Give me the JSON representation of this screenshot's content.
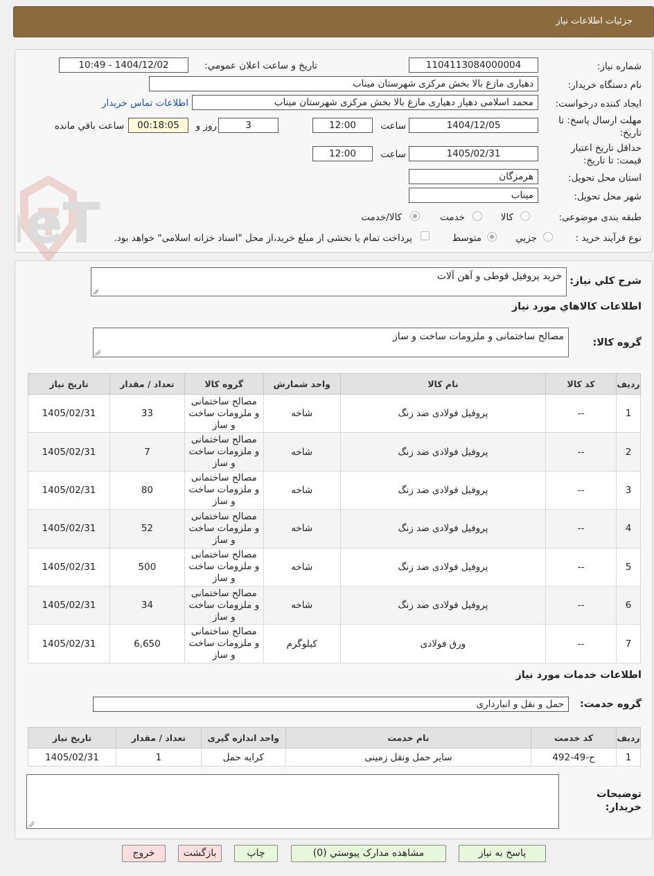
{
  "header": {
    "title": "جزئیات اطلاعات نیاز"
  },
  "details": {
    "need_number_label": "شماره نیاز:",
    "need_number": "1104113084000004",
    "announce_label": "تاریخ و ساعت اعلان عمومي:",
    "announce_value": "1404/12/02 - 10:49",
    "buyer_org_label": "نام دستگاه خريدار:",
    "buyer_org": "دهیاری مازغ بالا بخش مرکزی شهرستان میناب",
    "requester_label": "ایجاد کننده درخواست:",
    "requester": "محمد اسلامی دهیار دهیاری مازغ بالا بخش مرکزی شهرستان میناب",
    "contact_link": "اطلاعات تماس خریدار",
    "reply_deadline_label_1": "مهلت ارسال پاسخ: تا",
    "reply_deadline_label_2": "تاریخ:",
    "reply_date": "1404/12/05",
    "time_label": "ساعت",
    "reply_time": "12:00",
    "days_value": "3",
    "days_label": "روز و",
    "remaining_time": "00:18:05",
    "remaining_label": "ساعت باقي مانده",
    "price_valid_label_1": "حداقل تاریخ اعتبار",
    "price_valid_label_2": "قیمت: تا تاریخ:",
    "price_valid_date": "1405/02/31",
    "price_valid_time": "12:00",
    "province_label": "استان محل تحویل:",
    "province": "هرمزگان",
    "city_label": "شهر محل تحویل:",
    "city": "میناب",
    "category_label": "طبقه بندی موضوعی:",
    "category_options": [
      "کالا",
      "خدمت",
      "کالا/خدمت"
    ],
    "process_label": "نوع فرآیند خرید :",
    "process_options": [
      "جزيي",
      "متوسط"
    ],
    "payment_note": "پرداخت تمام یا بخشی از مبلغ خرید،از محل \"اسناد خزانه اسلامی\" خواهد بود."
  },
  "summary": {
    "description_label": "شرح کلي نياز:",
    "description": "خرید پروفیل قوطی و آهن آلات",
    "goods_section_title": "اطلاعات کالاهاي مورد نياز",
    "goods_group_label": "گروه کالا:",
    "goods_group": "مصالح ساختمانی و ملزومات ساخت و ساز"
  },
  "goods_table": {
    "headers": [
      "رديف",
      "کد کالا",
      "نام کالا",
      "واحد شمارش",
      "گروه کالا",
      "تعداد / مقدار",
      "تاريخ نياز"
    ],
    "rows": [
      [
        "1",
        "--",
        "پروفیل فولادی ضد زنگ",
        "شاخه",
        "مصالح ساختمانی و ملزومات ساخت و ساز",
        "33",
        "1405/02/31"
      ],
      [
        "2",
        "--",
        "پروفیل فولادی ضد زنگ",
        "شاخه",
        "مصالح ساختمانی و ملزومات ساخت و ساز",
        "7",
        "1405/02/31"
      ],
      [
        "3",
        "--",
        "پروفیل فولادی ضد زنگ",
        "شاخه",
        "مصالح ساختمانی و ملزومات ساخت و ساز",
        "80",
        "1405/02/31"
      ],
      [
        "4",
        "--",
        "پروفیل فولادی ضد زنگ",
        "شاخه",
        "مصالح ساختمانی و ملزومات ساخت و ساز",
        "52",
        "1405/02/31"
      ],
      [
        "5",
        "--",
        "پروفیل فولادی ضد زنگ",
        "شاخه",
        "مصالح ساختمانی و ملزومات ساخت و ساز",
        "500",
        "1405/02/31"
      ],
      [
        "6",
        "--",
        "پروفیل فولادی ضد زنگ",
        "شاخه",
        "مصالح ساختمانی و ملزومات ساخت و ساز",
        "34",
        "1405/02/31"
      ],
      [
        "7",
        "--",
        "ورق فولادی",
        "کیلوگرم",
        "مصالح ساختمانی و ملزومات ساخت و ساز",
        "6,650",
        "1405/02/31"
      ]
    ]
  },
  "services": {
    "section_title": "اطلاعات خدمات مورد نياز",
    "group_label": "گروه خدمت:",
    "group": "حمل و نقل و انبارداری"
  },
  "services_table": {
    "headers": [
      "رديف",
      "کد خدمت",
      "نام خدمت",
      "واحد اندازه گيری",
      "تعداد / مقدار",
      "تاريخ نياز"
    ],
    "rows": [
      [
        "1",
        "ح-49-492",
        "سایر حمل ونقل زمینی",
        "کرایه حمل",
        "1",
        "1405/02/31"
      ]
    ]
  },
  "buyer_notes": {
    "label_1": "توضیحات",
    "label_2": "خریدار:",
    "value": ""
  },
  "buttons": {
    "reply": "پاسخ به نیاز",
    "attachments": "مشاهده مدارک پیوستي (0)",
    "print": "چاپ",
    "back": "بازگشت",
    "exit": "خروج"
  },
  "watermark": {
    "text": "AriaTender.neT"
  }
}
